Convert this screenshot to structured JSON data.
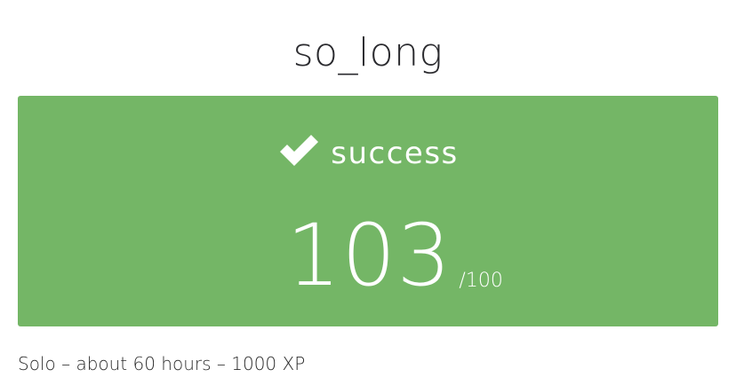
{
  "project": {
    "title": "so_long"
  },
  "result": {
    "status": "success",
    "status_icon": "check-icon",
    "score": "103",
    "score_max": "/100",
    "card_color": "#74b666"
  },
  "meta": {
    "description": "Solo – about 60 hours – 1000 XP"
  }
}
